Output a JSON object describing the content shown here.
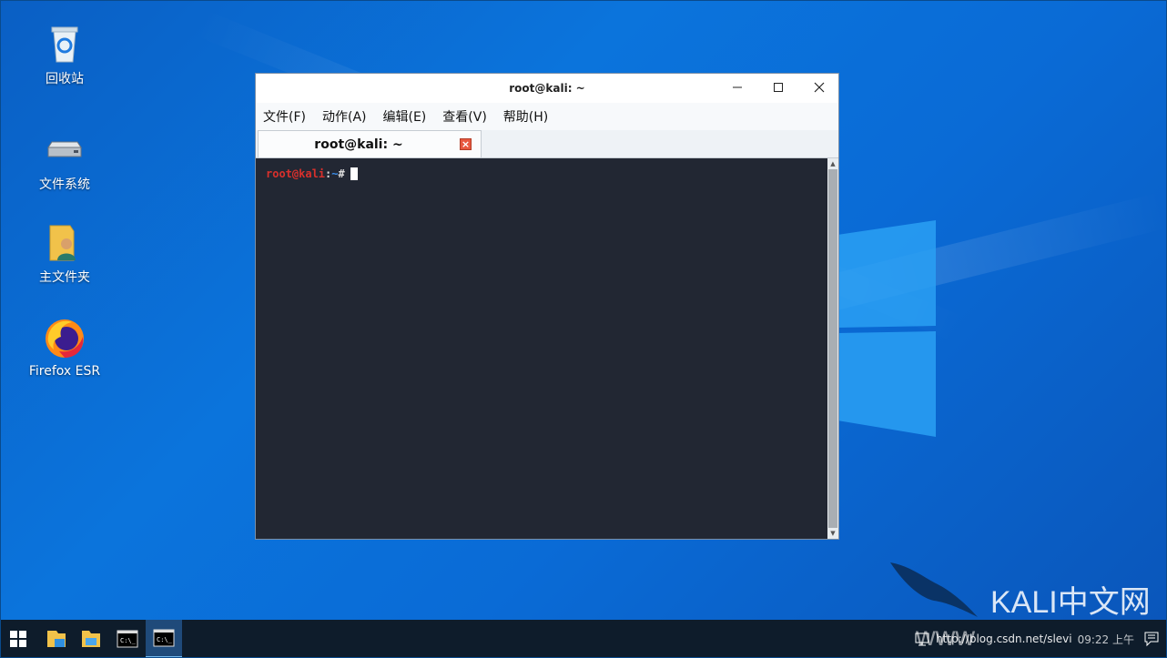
{
  "desktop": {
    "icons": [
      {
        "label": "回收站",
        "icon": "recycle-bin-icon"
      },
      {
        "label": "文件系统",
        "icon": "drive-icon"
      },
      {
        "label": "主文件夹",
        "icon": "home-folder-icon"
      },
      {
        "label": "Firefox ESR",
        "icon": "firefox-icon"
      }
    ]
  },
  "window": {
    "title": "root@kali: ~",
    "menu": [
      {
        "label": "文件(F)"
      },
      {
        "label": "动作(A)"
      },
      {
        "label": "编辑(E)"
      },
      {
        "label": "查看(V)"
      },
      {
        "label": "帮助(H)"
      }
    ],
    "tab": {
      "label": "root@kali: ~",
      "close": "×"
    },
    "terminal": {
      "user_host": "root@kali",
      "sep": ":",
      "path": "~",
      "symbol": "#"
    }
  },
  "taskbar": {
    "tray_text": "http://blog.csdn.net/slevi",
    "time": "09:22 上午"
  },
  "watermark": {
    "brand": "KALI中文网",
    "www": "www"
  },
  "colors": {
    "desktop": "#0a6bd6",
    "terminal_bg": "#222733",
    "prompt_user": "#d9302c",
    "prompt_path": "#3b8eea",
    "taskbar": "#0e1c2b"
  }
}
